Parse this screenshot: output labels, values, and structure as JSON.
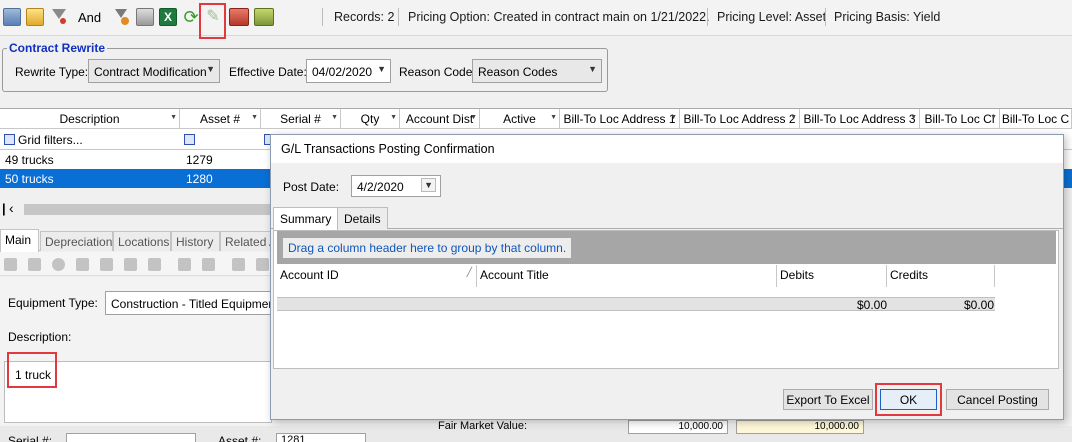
{
  "toolbar": {
    "and_label": "And",
    "records": "Records: 2",
    "pricing_option": "Pricing Option: Created in contract main on 1/21/2022.",
    "pricing_level": "Pricing Level: Asset",
    "pricing_basis": "Pricing Basis: Yield"
  },
  "rewrite": {
    "title": "Contract Rewrite",
    "type_label": "Rewrite Type:",
    "type_value": "Contract Modification",
    "effective_label": "Effective Date:",
    "effective_value": "04/02/2020",
    "reason_label": "Reason Code:",
    "reason_value": "Reason Codes"
  },
  "grid": {
    "columns": [
      "Description",
      "Asset #",
      "Serial #",
      "Qty",
      "Account Dist",
      "Active",
      "Bill-To Loc Address 1",
      "Bill-To Loc Address 2",
      "Bill-To Loc Address 3",
      "Bill-To Loc Ci",
      "Bill-To Loc C"
    ],
    "filter_label": "Grid filters...",
    "rows": [
      {
        "description": "49 trucks",
        "asset": "1279"
      },
      {
        "description": "50 trucks",
        "asset": "1280"
      }
    ]
  },
  "tabs": [
    "Main",
    "Depreciation",
    "Locations",
    "History",
    "Related A"
  ],
  "form": {
    "equipment_type_label": "Equipment Type:",
    "equipment_type_value": "Construction - Titled Equipment",
    "description_label": "Description:",
    "description_value": "1 truck",
    "serial_label": "Serial #:",
    "asset_label": "Asset #:",
    "asset_value": "1281",
    "fmv_label": "Fair Market Value:",
    "fmv_value_1": "10,000.00",
    "fmv_value_2": "10,000.00"
  },
  "dialog": {
    "title": "G/L Transactions Posting Confirmation",
    "post_date_label": "Post Date:",
    "post_date_value": "4/2/2020",
    "tabs": [
      "Summary",
      "Details"
    ],
    "group_hint": "Drag a column header here to group by that column.",
    "columns": [
      "Account ID",
      "Account Title",
      "Debits",
      "Credits"
    ],
    "debits_total": "$0.00",
    "credits_total": "$0.00",
    "export_button": "Export To Excel",
    "ok_button": "OK",
    "cancel_button": "Cancel Posting"
  },
  "colors": {
    "accent": "#0a6fd4",
    "highlight": "#e0393e",
    "group_title": "#1030c0"
  }
}
